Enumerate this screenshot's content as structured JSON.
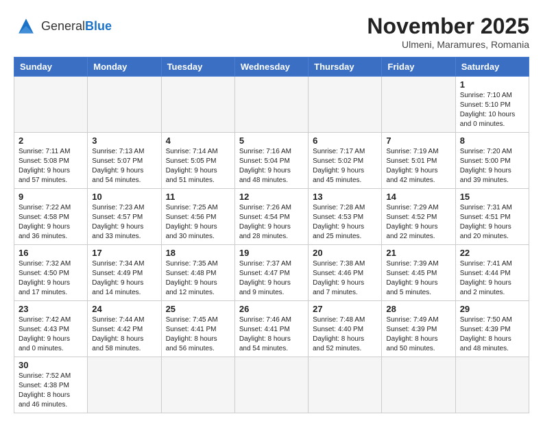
{
  "header": {
    "logo_general": "General",
    "logo_blue": "Blue",
    "month_title": "November 2025",
    "location": "Ulmeni, Maramures, Romania"
  },
  "weekdays": [
    "Sunday",
    "Monday",
    "Tuesday",
    "Wednesday",
    "Thursday",
    "Friday",
    "Saturday"
  ],
  "weeks": [
    [
      {
        "day": "",
        "info": "",
        "empty": true
      },
      {
        "day": "",
        "info": "",
        "empty": true
      },
      {
        "day": "",
        "info": "",
        "empty": true
      },
      {
        "day": "",
        "info": "",
        "empty": true
      },
      {
        "day": "",
        "info": "",
        "empty": true
      },
      {
        "day": "",
        "info": "",
        "empty": true
      },
      {
        "day": "1",
        "info": "Sunrise: 7:10 AM\nSunset: 5:10 PM\nDaylight: 10 hours and 0 minutes.",
        "empty": false
      }
    ],
    [
      {
        "day": "2",
        "info": "Sunrise: 7:11 AM\nSunset: 5:08 PM\nDaylight: 9 hours and 57 minutes.",
        "empty": false
      },
      {
        "day": "3",
        "info": "Sunrise: 7:13 AM\nSunset: 5:07 PM\nDaylight: 9 hours and 54 minutes.",
        "empty": false
      },
      {
        "day": "4",
        "info": "Sunrise: 7:14 AM\nSunset: 5:05 PM\nDaylight: 9 hours and 51 minutes.",
        "empty": false
      },
      {
        "day": "5",
        "info": "Sunrise: 7:16 AM\nSunset: 5:04 PM\nDaylight: 9 hours and 48 minutes.",
        "empty": false
      },
      {
        "day": "6",
        "info": "Sunrise: 7:17 AM\nSunset: 5:02 PM\nDaylight: 9 hours and 45 minutes.",
        "empty": false
      },
      {
        "day": "7",
        "info": "Sunrise: 7:19 AM\nSunset: 5:01 PM\nDaylight: 9 hours and 42 minutes.",
        "empty": false
      },
      {
        "day": "8",
        "info": "Sunrise: 7:20 AM\nSunset: 5:00 PM\nDaylight: 9 hours and 39 minutes.",
        "empty": false
      }
    ],
    [
      {
        "day": "9",
        "info": "Sunrise: 7:22 AM\nSunset: 4:58 PM\nDaylight: 9 hours and 36 minutes.",
        "empty": false
      },
      {
        "day": "10",
        "info": "Sunrise: 7:23 AM\nSunset: 4:57 PM\nDaylight: 9 hours and 33 minutes.",
        "empty": false
      },
      {
        "day": "11",
        "info": "Sunrise: 7:25 AM\nSunset: 4:56 PM\nDaylight: 9 hours and 30 minutes.",
        "empty": false
      },
      {
        "day": "12",
        "info": "Sunrise: 7:26 AM\nSunset: 4:54 PM\nDaylight: 9 hours and 28 minutes.",
        "empty": false
      },
      {
        "day": "13",
        "info": "Sunrise: 7:28 AM\nSunset: 4:53 PM\nDaylight: 9 hours and 25 minutes.",
        "empty": false
      },
      {
        "day": "14",
        "info": "Sunrise: 7:29 AM\nSunset: 4:52 PM\nDaylight: 9 hours and 22 minutes.",
        "empty": false
      },
      {
        "day": "15",
        "info": "Sunrise: 7:31 AM\nSunset: 4:51 PM\nDaylight: 9 hours and 20 minutes.",
        "empty": false
      }
    ],
    [
      {
        "day": "16",
        "info": "Sunrise: 7:32 AM\nSunset: 4:50 PM\nDaylight: 9 hours and 17 minutes.",
        "empty": false
      },
      {
        "day": "17",
        "info": "Sunrise: 7:34 AM\nSunset: 4:49 PM\nDaylight: 9 hours and 14 minutes.",
        "empty": false
      },
      {
        "day": "18",
        "info": "Sunrise: 7:35 AM\nSunset: 4:48 PM\nDaylight: 9 hours and 12 minutes.",
        "empty": false
      },
      {
        "day": "19",
        "info": "Sunrise: 7:37 AM\nSunset: 4:47 PM\nDaylight: 9 hours and 9 minutes.",
        "empty": false
      },
      {
        "day": "20",
        "info": "Sunrise: 7:38 AM\nSunset: 4:46 PM\nDaylight: 9 hours and 7 minutes.",
        "empty": false
      },
      {
        "day": "21",
        "info": "Sunrise: 7:39 AM\nSunset: 4:45 PM\nDaylight: 9 hours and 5 minutes.",
        "empty": false
      },
      {
        "day": "22",
        "info": "Sunrise: 7:41 AM\nSunset: 4:44 PM\nDaylight: 9 hours and 2 minutes.",
        "empty": false
      }
    ],
    [
      {
        "day": "23",
        "info": "Sunrise: 7:42 AM\nSunset: 4:43 PM\nDaylight: 9 hours and 0 minutes.",
        "empty": false
      },
      {
        "day": "24",
        "info": "Sunrise: 7:44 AM\nSunset: 4:42 PM\nDaylight: 8 hours and 58 minutes.",
        "empty": false
      },
      {
        "day": "25",
        "info": "Sunrise: 7:45 AM\nSunset: 4:41 PM\nDaylight: 8 hours and 56 minutes.",
        "empty": false
      },
      {
        "day": "26",
        "info": "Sunrise: 7:46 AM\nSunset: 4:41 PM\nDaylight: 8 hours and 54 minutes.",
        "empty": false
      },
      {
        "day": "27",
        "info": "Sunrise: 7:48 AM\nSunset: 4:40 PM\nDaylight: 8 hours and 52 minutes.",
        "empty": false
      },
      {
        "day": "28",
        "info": "Sunrise: 7:49 AM\nSunset: 4:39 PM\nDaylight: 8 hours and 50 minutes.",
        "empty": false
      },
      {
        "day": "29",
        "info": "Sunrise: 7:50 AM\nSunset: 4:39 PM\nDaylight: 8 hours and 48 minutes.",
        "empty": false
      }
    ],
    [
      {
        "day": "30",
        "info": "Sunrise: 7:52 AM\nSunset: 4:38 PM\nDaylight: 8 hours and 46 minutes.",
        "empty": false
      },
      {
        "day": "",
        "info": "",
        "empty": true
      },
      {
        "day": "",
        "info": "",
        "empty": true
      },
      {
        "day": "",
        "info": "",
        "empty": true
      },
      {
        "day": "",
        "info": "",
        "empty": true
      },
      {
        "day": "",
        "info": "",
        "empty": true
      },
      {
        "day": "",
        "info": "",
        "empty": true
      }
    ]
  ]
}
